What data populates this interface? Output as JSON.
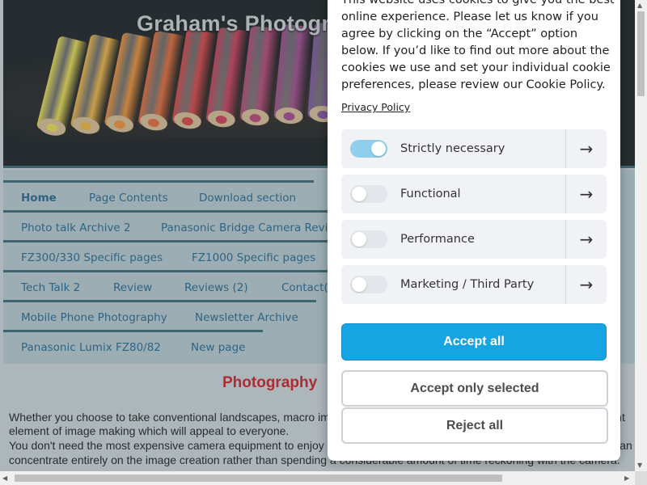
{
  "site": {
    "title": "Graham's Photography Series"
  },
  "nav": {
    "rows": [
      [
        "Home",
        "Page Contents",
        "Download section"
      ],
      [
        "Photo talk Archive 2",
        "Panasonic Bridge Camera Revisited"
      ],
      [
        "FZ300/330 Specific pages",
        "FZ1000 Specific pages"
      ],
      [
        "Tech Talk 2",
        "Review",
        "Reviews (2)",
        "Contact(s)"
      ],
      [
        "Mobile Phone Photography",
        "Newsletter Archive"
      ],
      [
        "Panasonic Lumix FZ80/82",
        "New page"
      ]
    ],
    "active": "Home"
  },
  "content": {
    "heading": "Photography",
    "lines": [
      "Whether you choose to take conventional landscapes, macro images, or simply record family events there should be a light",
      "element of image making which will appeal to everyone.",
      "You don't need the most expensive camera equipment to enjoy photography, and by being familiar with your camera you can",
      "concentrate entirely on the image creation rather than spending a considerable amount of time reckoning with the camera."
    ]
  },
  "cookie": {
    "text_lines": [
      "This website uses cookies to give you the best",
      "online experience. Please let us know if you",
      "agree by clicking on the “Accept” option",
      "below. If you’d like to find out more about the",
      "cookies we use and set your individual cookie",
      "preferences, please review our Cookie Policy."
    ],
    "privacy_link": "Privacy Policy",
    "preferences": [
      {
        "label": "Strictly necessary",
        "enabled": true
      },
      {
        "label": "Functional",
        "enabled": false
      },
      {
        "label": "Performance",
        "enabled": false
      },
      {
        "label": "Marketing / Third Party",
        "enabled": false
      }
    ],
    "accept_all": "Accept all",
    "accept_selected": "Accept only selected",
    "reject_all": "Reject all"
  },
  "icons": {
    "pref_arrow": "→",
    "scroll_up": "▲",
    "scroll_down": "▼",
    "scroll_left": "◀",
    "scroll_right": "▶"
  },
  "colors": {
    "accent": "#17a4e2",
    "toggle_on": "#8fcfec",
    "heading": "#c4161c",
    "nav_link": "#1b5f8a",
    "nav_border": "#33606e"
  }
}
